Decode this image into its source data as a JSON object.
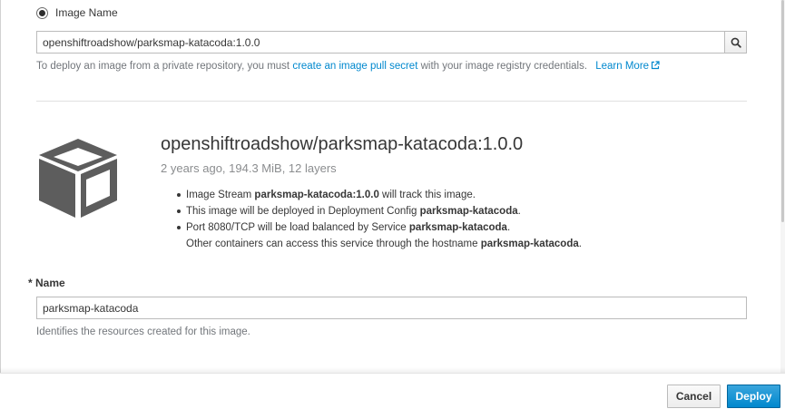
{
  "image_source": {
    "radio_label": "Image Name",
    "radio_selected": true,
    "search_value": "openshiftroadshow/parksmap-katacoda:1.0.0",
    "search_icon": "search-icon"
  },
  "help": {
    "prefix": "To deploy an image from a private repository, you must ",
    "pull_secret_link": "create an image pull secret",
    "suffix": " with your image registry credentials.",
    "learn_more": "Learn More",
    "learn_more_icon": "external-link-icon"
  },
  "image_info": {
    "icon": "cube-icon",
    "title": "openshiftroadshow/parksmap-katacoda:1.0.0",
    "meta": "2 years ago, 194.3 MiB, 12 layers",
    "items": [
      {
        "prefix": "Image Stream ",
        "bold": "parksmap-katacoda:1.0.0",
        "suffix": " will track this image."
      },
      {
        "prefix": "This image will be deployed in Deployment Config ",
        "bold": "parksmap-katacoda",
        "suffix": "."
      },
      {
        "prefix": "Port 8080/TCP will be load balanced by Service ",
        "bold": "parksmap-katacoda",
        "suffix": "."
      },
      {
        "prefix": "Other containers can access this service through the hostname ",
        "bold": "parksmap-katacoda",
        "suffix": "."
      }
    ]
  },
  "name_field": {
    "label": "* Name",
    "value": "parksmap-katacoda",
    "help": "Identifies the resources created for this image."
  },
  "footer": {
    "cancel_label": "Cancel",
    "deploy_label": "Deploy"
  },
  "colors": {
    "link": "#0088ce",
    "primary_button": "#0088ce",
    "cube": "#5d5d5d"
  }
}
